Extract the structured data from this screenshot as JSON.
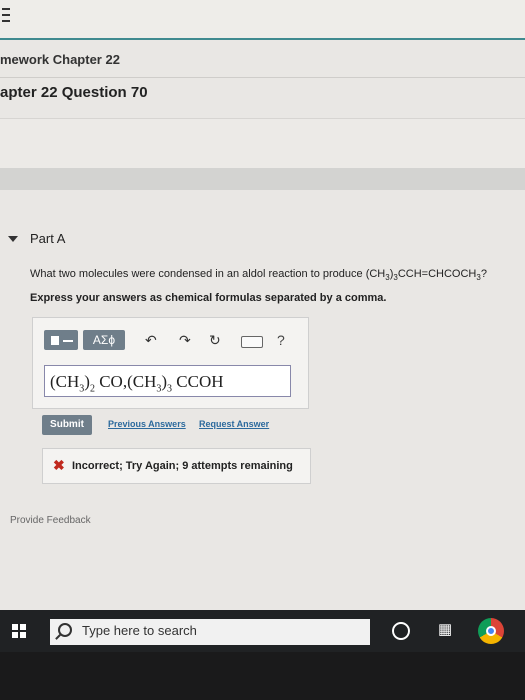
{
  "breadcrumb": "mework Chapter 22",
  "page_title": "apter 22 Question 70",
  "part": {
    "label": "Part A",
    "question_prefix": "What two molecules were condensed in an aldol reaction to produce (CH",
    "q_sub1": "3",
    "q_mid": ")",
    "q_sub2": "3",
    "q_mid2": "CCH=CHCOCH",
    "q_sub3": "3",
    "q_end": "?",
    "instructions": "Express your answers as chemical formulas separated by a comma."
  },
  "toolbar": {
    "greek_label": "ΑΣϕ",
    "undo_icon": "undo-arrow",
    "redo_icon": "redo-arrow",
    "reset_icon": "reset-circle",
    "keyboard_icon": "keyboard",
    "help_label": "?"
  },
  "answer": {
    "p1": "(CH",
    "s1": "3",
    "p2": ")",
    "s2": "2",
    "p3": " CO,(CH",
    "s3": "3",
    "p4": ")",
    "s4": "3",
    "p5": " CCOH"
  },
  "actions": {
    "submit": "Submit",
    "previous_answers": "Previous Answers",
    "request_answer": "Request Answer"
  },
  "feedback": {
    "icon": "x-mark",
    "text": "Incorrect; Try Again; 9 attempts remaining"
  },
  "provide_feedback": "Provide Feedback",
  "taskbar": {
    "search_placeholder": "Type here to search"
  }
}
